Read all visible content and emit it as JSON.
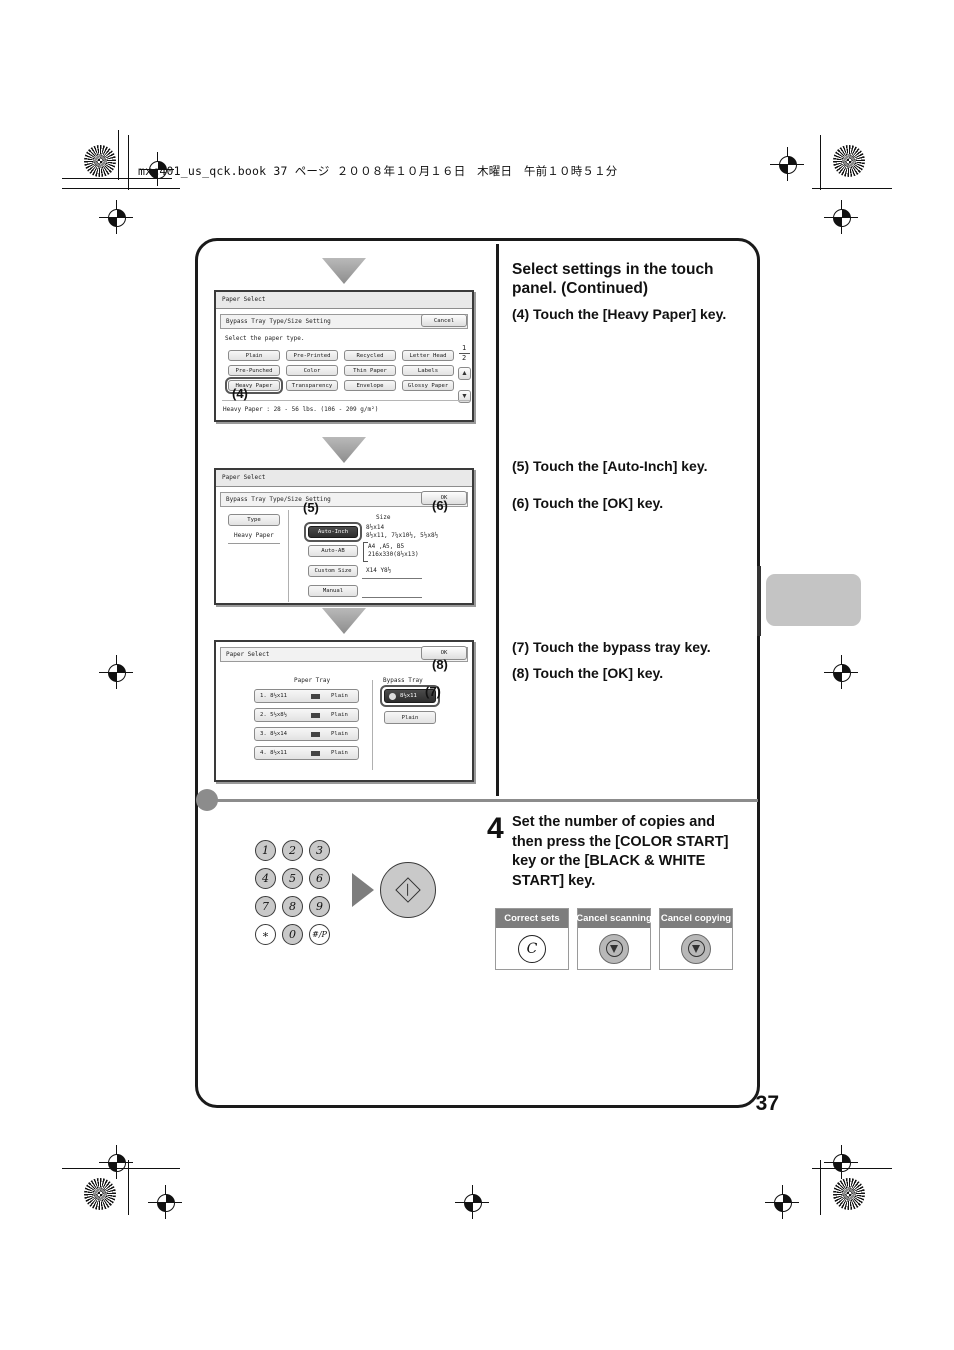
{
  "header": {
    "book_line": "mxc401_us_qck.book  37 ページ  ２００８年１０月１６日　木曜日　午前１０時５１分"
  },
  "page_number": "37",
  "right_column": {
    "heading": "Select settings in the touch panel. (Continued)",
    "step4_instruction": "(4) Touch the [Heavy Paper] key.",
    "step5_instruction": "(5) Touch the [Auto-Inch] key.",
    "step6_instruction": "(6) Touch the [OK] key.",
    "step7_instruction": "(7) Touch the bypass tray key.",
    "step8_instruction": "(8) Touch the [OK] key."
  },
  "panel1": {
    "title": "Paper Select",
    "subtitle": "Bypass Tray Type/Size Setting",
    "cancel_label": "Cancel",
    "prompt": "Select the paper type.",
    "paper_types": [
      "Plain",
      "Pre-Printed",
      "Recycled",
      "Letter Head",
      "Pre-Punched",
      "Color",
      "Thin Paper",
      "Labels",
      "Heavy Paper",
      "Transparency",
      "Envelope",
      "Glossy Paper"
    ],
    "selected_type": "Heavy Paper",
    "page_indicator_top": "1",
    "page_indicator_bottom": "2",
    "scroll_up_icon": "arrow-up-icon",
    "scroll_down_icon": "arrow-down-icon",
    "footer_note": "Heavy Paper : 28 - 56 lbs. (106 - 209 g/m²)",
    "callout": "(4)"
  },
  "panel2": {
    "title": "Paper Select",
    "subtitle": "Bypass Tray Type/Size Setting",
    "ok_label": "OK",
    "type_tab": "Type",
    "type_value": "Heavy Paper",
    "size_header": "Size",
    "options": [
      {
        "label": "Auto-Inch",
        "detail_line1": "8½x14",
        "detail_line2": "8½x11, 7¼x10½, 5½x8½",
        "selected": true
      },
      {
        "label": "Auto-AB",
        "detail_line1": "A4 ,A5, B5",
        "detail_line2": "216x330(8½x13)",
        "selected": false
      },
      {
        "label": "Custom Size",
        "detail_line1": "X14  Y8½",
        "detail_line2": "",
        "selected": false
      },
      {
        "label": "Manual",
        "detail_line1": "",
        "detail_line2": "",
        "selected": false
      }
    ],
    "callout5": "(5)",
    "callout6": "(6)"
  },
  "panel3": {
    "title": "Paper Select",
    "ok_label": "OK",
    "paper_tray_header": "Paper Tray",
    "bypass_tray_header": "Bypass Tray",
    "trays": [
      {
        "label": "1. 8½x11",
        "icon": "tray-icon",
        "type": "Plain"
      },
      {
        "label": "2. 5½x8½",
        "icon": "tray-icon",
        "type": "Plain"
      },
      {
        "label": "3. 8½x14",
        "icon": "tray-icon",
        "type": "Plain"
      },
      {
        "label": "4. 8½x11",
        "icon": "tray-icon",
        "type": "Plain"
      }
    ],
    "bypass_size": "8½x11",
    "bypass_type": "Plain",
    "callout7": "(7)",
    "callout8": "(8)"
  },
  "step4": {
    "number": "4",
    "text": "Set the number of copies and then press the [COLOR START] key or the [BLACK & WHITE START] key."
  },
  "keypad": {
    "keys": [
      "1",
      "2",
      "3",
      "4",
      "5",
      "6",
      "7",
      "8",
      "9",
      "∗",
      "0",
      "#/P"
    ],
    "start_icon": "start-key-icon",
    "arrow_icon": "right-arrow-icon"
  },
  "cancel_boxes": [
    {
      "label": "Correct sets",
      "icon": "c-clear-icon"
    },
    {
      "label": "Cancel scanning",
      "icon": "stop-icon"
    },
    {
      "label": "Cancel copying",
      "icon": "stop-icon"
    }
  ],
  "colors": {
    "frame": "#1a1a1a",
    "gray": "#7d7d7d",
    "tab": "#c4c4c4"
  }
}
